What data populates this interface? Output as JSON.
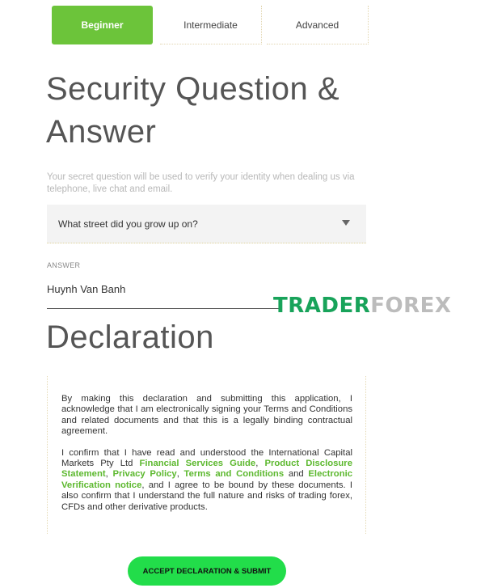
{
  "tabs": [
    {
      "label": "Beginner",
      "active": true
    },
    {
      "label": "Intermediate",
      "active": false
    },
    {
      "label": "Advanced",
      "active": false
    }
  ],
  "security": {
    "title": "Security Question & Answer",
    "helper": "Your secret question will be used to verify your identity when dealing us via telephone, live chat and email.",
    "question": "What street did you grow up on?",
    "answer_label": "ANSWER",
    "answer_value": "Huynh Van Banh"
  },
  "watermark": {
    "part1": "TRADER",
    "part2": "FOREX"
  },
  "declaration": {
    "title": "Declaration",
    "para1": "By making this declaration and submitting this application, I acknowledge that I am electronically signing your Terms and Conditions and related documents and that this is a legally binding contractual agreement.",
    "p2_a": "I confirm that I have read and understood the International Capital Markets Pty Ltd ",
    "link_fsg": "Financial Services Guide",
    "sep1": ", ",
    "link_pds": "Product Disclosure Statement",
    "sep2": ", ",
    "link_privacy": "Privacy Policy",
    "sep3": ", ",
    "link_terms": "Terms and Conditions",
    "and_word": " and ",
    "link_evn": "Electronic Verification notice",
    "p2_b": ", and I agree to be bound by these documents. I also confirm that I understand the full nature and risks of trading forex, CFDs and other derivative products.",
    "submit_label": "ACCEPT DECLARATION & SUBMIT"
  },
  "colors": {
    "accent_green": "#6cc43a",
    "submit_green": "#22dd4a",
    "link_green": "#5cb82e",
    "watermark_green": "#18a35a"
  }
}
